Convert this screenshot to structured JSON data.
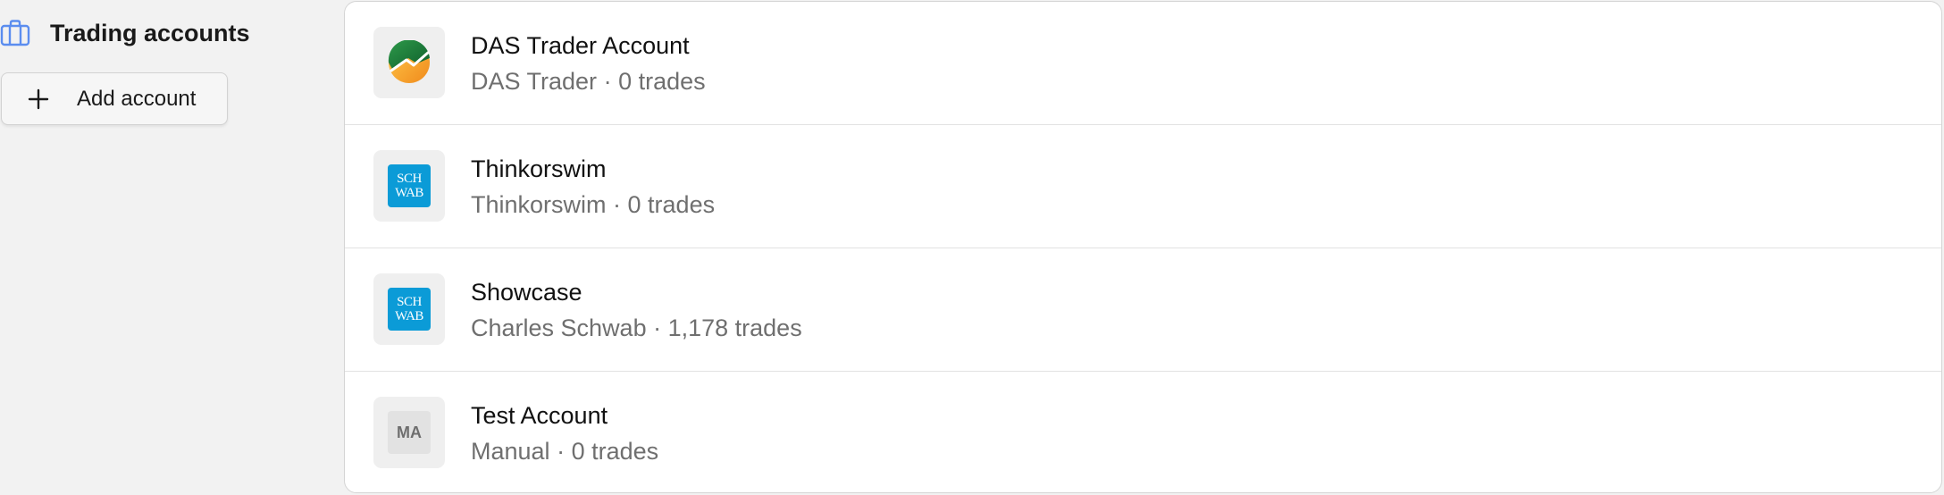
{
  "sidebar": {
    "title": "Trading accounts",
    "title_icon": "briefcase-icon",
    "add_button_label": "Add account",
    "add_button_icon": "plus-icon"
  },
  "accounts": [
    {
      "name": "DAS Trader Account",
      "platform": "DAS Trader",
      "trades": "0 trades",
      "logo": "das-trader-logo"
    },
    {
      "name": "Thinkorswim",
      "platform": "Thinkorswim",
      "trades": "0 trades",
      "logo": "schwab-logo",
      "logo_text": [
        "SCH",
        "WAB"
      ]
    },
    {
      "name": "Showcase",
      "platform": "Charles Schwab",
      "trades": "1,178 trades",
      "logo": "schwab-logo",
      "logo_text": [
        "SCH",
        "WAB"
      ]
    },
    {
      "name": "Test Account",
      "platform": "Manual",
      "trades": "0 trades",
      "logo": "manual-initials",
      "logo_text": "MA"
    }
  ],
  "separator": " · ",
  "colors": {
    "accent_icon": "#5b8def",
    "schwab_blue": "#0b9bd7",
    "background": "#f2f2f2"
  }
}
